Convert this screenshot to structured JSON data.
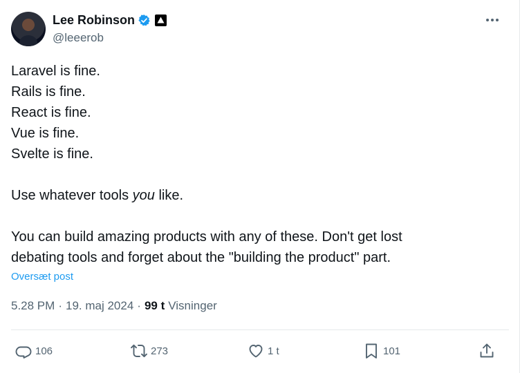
{
  "author": {
    "display_name": "Lee Robinson",
    "handle": "@leeerob",
    "verified_icon": "verified-badge-icon",
    "affiliate_icon": "vercel-triangle-icon"
  },
  "tweet": {
    "lines": [
      "Laravel is fine.",
      "Rails is fine.",
      "React is fine.",
      "Vue is fine.",
      "Svelte is fine."
    ],
    "tools_prefix": "Use whatever tools ",
    "tools_emph": "you",
    "tools_suffix": " like.",
    "closing_line_1": "You can build amazing products with any of these. Don't get lost",
    "closing_line_2": "debating tools and forget about the \"building the product\" part.",
    "translate_label": "Oversæt post"
  },
  "meta": {
    "time": "5.28 PM",
    "date": "19. maj 2024",
    "views_count": "99 t",
    "views_label": "Visninger",
    "separator": "·"
  },
  "actions": {
    "replies": "106",
    "reposts": "273",
    "likes": "1 t",
    "bookmarks": "101"
  },
  "colors": {
    "link": "#1d9bf0",
    "secondary_text": "#536471",
    "primary_text": "#0f1419"
  }
}
